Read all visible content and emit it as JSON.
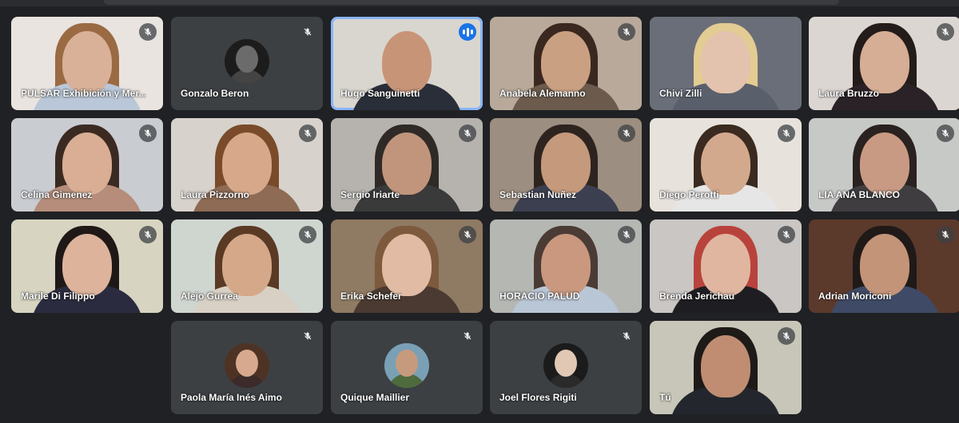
{
  "meeting": {
    "participants": [
      {
        "name": "PULSAR Exhibición y Mer...",
        "mic": "muted",
        "view": "video",
        "bg": "#e9e4df",
        "skin": "#d8b198",
        "hair": "#9a6a43",
        "shirt": "#b9c7d8"
      },
      {
        "name": "Gonzalo Beron",
        "mic": "muted",
        "view": "avatar",
        "bg": "#3c4043",
        "skin": "#6b6b6b",
        "hair": "#1c1c1c",
        "shirt": "#444444"
      },
      {
        "name": "Hugo Sanguinetti",
        "mic": "speaking",
        "view": "video",
        "bg": "#d8d6cf",
        "skin": "#c89478",
        "hair": "#d8d6cf",
        "shirt": "#2a2e38",
        "active": true
      },
      {
        "name": "Anabela Alemanno",
        "mic": "muted",
        "view": "video",
        "bg": "#b8a99a",
        "skin": "#caa082",
        "hair": "#3a2820",
        "shirt": "#6c5b4c"
      },
      {
        "name": "Chivi Zilli",
        "mic": "none",
        "view": "video",
        "bg": "#6a6e78",
        "skin": "#e3c2ae",
        "hair": "#e3cc93",
        "shirt": "#5a5f6c"
      },
      {
        "name": "Laura Bruzzo",
        "mic": "muted",
        "view": "video",
        "bg": "#dcd6d2",
        "skin": "#d6ad95",
        "hair": "#231c1a",
        "shirt": "#2a2226"
      },
      {
        "name": "Celina Gimenez",
        "mic": "muted",
        "view": "video",
        "bg": "#c9ccd1",
        "skin": "#d9ae94",
        "hair": "#3b2a22",
        "shirt": "#b58d7a"
      },
      {
        "name": "Laura Pizzorno",
        "mic": "muted",
        "view": "video",
        "bg": "#d7d2cc",
        "skin": "#d7a88a",
        "hair": "#7a4b2b",
        "shirt": "#8d6b55"
      },
      {
        "name": "Sergio Iriarte",
        "mic": "muted",
        "view": "video",
        "bg": "#b6b3ae",
        "skin": "#c0957c",
        "hair": "#2f2a27",
        "shirt": "#3a3a3a"
      },
      {
        "name": "Sebastian Nuñez",
        "mic": "muted",
        "view": "video",
        "bg": "#9c8e80",
        "skin": "#c4997c",
        "hair": "#2e241f",
        "shirt": "#3b3f50"
      },
      {
        "name": "Diego Perotti",
        "mic": "muted",
        "view": "video",
        "bg": "#e7e2dc",
        "skin": "#d3a98d",
        "hair": "#3a2a20",
        "shirt": "#e6e6e6"
      },
      {
        "name": "LIA ANA BLANCO",
        "mic": "muted",
        "view": "video",
        "bg": "#c7c9c6",
        "skin": "#c99a83",
        "hair": "#2a2220",
        "shirt": "#3f3d3f"
      },
      {
        "name": "Marile Di Filippo",
        "mic": "muted",
        "view": "video",
        "bg": "#d7d5c1",
        "skin": "#ddb39c",
        "hair": "#1f1816",
        "shirt": "#2a2b3e"
      },
      {
        "name": "Alejo Gurrea",
        "mic": "muted",
        "view": "video",
        "bg": "#cfd6d0",
        "skin": "#d5a88a",
        "hair": "#5a3a24",
        "shirt": "#d8d0c4"
      },
      {
        "name": "Erika Schefer",
        "mic": "muted",
        "view": "video",
        "bg": "#8f7a63",
        "skin": "#e1bba3",
        "hair": "#7d5a3e",
        "shirt": "#4a3a32"
      },
      {
        "name": "HORACIO PALUD",
        "mic": "muted",
        "view": "video",
        "bg": "#b5b7b3",
        "skin": "#c9987f",
        "hair": "#4a3b34",
        "shirt": "#b9c6d6"
      },
      {
        "name": "Brenda Jerichau",
        "mic": "muted",
        "view": "video",
        "bg": "#c9c6c3",
        "skin": "#e0b6a0",
        "hair": "#b8433c",
        "shirt": "#1e1e22"
      },
      {
        "name": "Adrian Moriconi",
        "mic": "muted",
        "view": "video",
        "bg": "#5b3a2c",
        "skin": "#c49478",
        "hair": "#1f1a18",
        "shirt": "#3f4a66"
      },
      {
        "name": "Paola María Inés Aimo",
        "mic": "muted",
        "view": "avatar",
        "bg": "#3c4043",
        "skin": "#d7a98e",
        "hair": "#4e3324",
        "shirt": "#3c2b2a"
      },
      {
        "name": "Quique Maillier",
        "mic": "muted",
        "view": "avatar",
        "bg": "#3c4043",
        "skin": "#c69a7d",
        "hair": "#7aa0b6",
        "shirt": "#4d6b3d"
      },
      {
        "name": "Joel Flores Rigiti",
        "mic": "muted",
        "view": "avatar",
        "bg": "#3c4043",
        "skin": "#e0c8b5",
        "hair": "#1b1b1b",
        "shirt": "#2a2a2a"
      },
      {
        "name": "Tú",
        "mic": "muted",
        "view": "video",
        "bg": "#c8c6b8",
        "skin": "#c08d72",
        "hair": "#1e1a18",
        "shirt": "#23272d"
      }
    ]
  },
  "icons": {
    "muted": "mic-off-icon",
    "speaking": "audio-level-icon"
  },
  "colors": {
    "background": "#202124",
    "tile": "#3c4043",
    "active_border": "#8ab4f8",
    "speaking": "#1a73e8"
  }
}
